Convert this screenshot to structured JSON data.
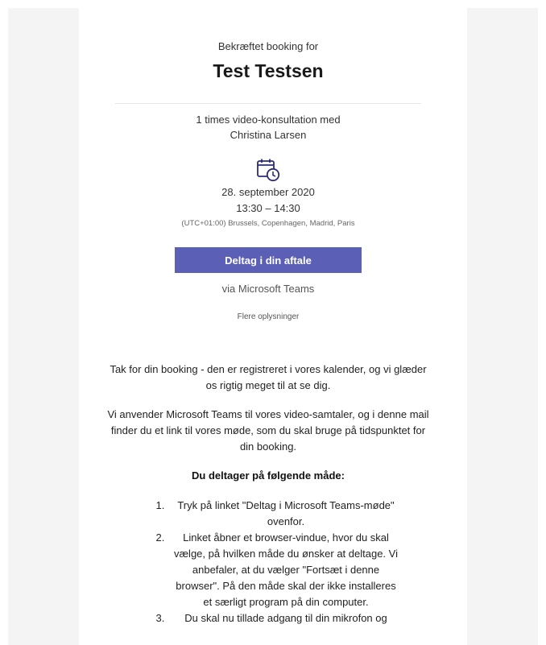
{
  "header": {
    "subtitle": "Bekræftet booking for",
    "name": "Test Testsen"
  },
  "service": {
    "line1": "1 times video-konsultation med",
    "line2": "Christina Larsen"
  },
  "appointment": {
    "icon": "calendar-clock-icon",
    "date": "28. september 2020",
    "time": "13:30 – 14:30",
    "timezone": "(UTC+01:00) Brussels, Copenhagen, Madrid, Paris"
  },
  "join": {
    "button_label": "Deltag i din aftale",
    "via": "via Microsoft Teams",
    "more_info": "Flere oplysninger"
  },
  "body": {
    "para1": "Tak for din booking - den er registreret i vores kalender, og vi glæder os rigtig meget til at se dig.",
    "para2": "Vi anvender Microsoft Teams til vores video-samtaler, og i denne mail finder du et link til vores møde, som du skal bruge på tidspunktet for din booking.",
    "subheading": "Du deltager på følgende måde:",
    "steps": [
      "Tryk på linket \"Deltag i Microsoft Teams-møde\" ovenfor.",
      "Linket åbner et browser-vindue, hvor du skal vælge, på hvilken måde du ønsker at deltage. Vi anbefaler, at du vælger \"Fortsæt i denne browser\". På den måde skal der ikke installeres et særligt program på din computer.",
      "Du skal nu tillade adgang til din mikrofon og"
    ]
  },
  "colors": {
    "accent": "#5b5fb6",
    "side_panel": "#f4f4f4"
  }
}
